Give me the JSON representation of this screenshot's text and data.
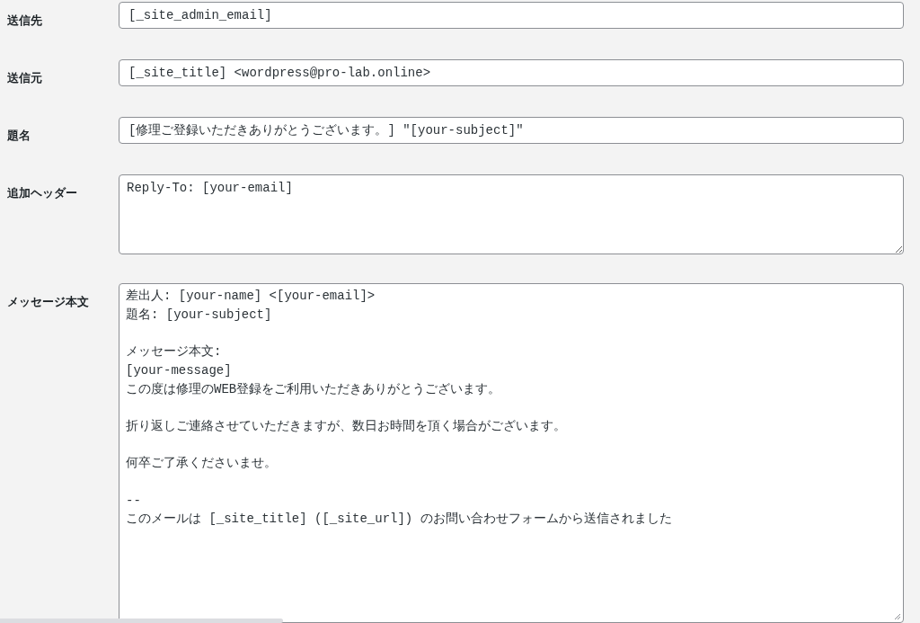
{
  "fields": [
    {
      "label": "送信先",
      "kind": "input",
      "value": "[_site_admin_email]"
    },
    {
      "label": "送信元",
      "kind": "input",
      "value": "[_site_title] <wordpress@pro-lab.online>"
    },
    {
      "label": "題名",
      "kind": "input",
      "value": "[修理ご登録いただきありがとうございます。] \"[your-subject]\""
    },
    {
      "label": "追加ヘッダー",
      "kind": "textarea",
      "value": "Reply-To: [your-email]"
    },
    {
      "label": "メッセージ本文",
      "kind": "textarea_large",
      "paragraphs": [
        [
          "差出人: [your-name] <[your-email]>",
          "題名: [your-subject]"
        ],
        [
          "メッセージ本文:",
          "[your-message]",
          "この度は修理のWEB登録をご利用いただきありがとうございます。"
        ],
        [
          "折り返しご連絡させていただきますが、数日お時間を頂く場合がございます。"
        ],
        [
          "何卒ご了承くださいませ。"
        ],
        [
          "--",
          "このメールは [_site_title] ([_site_url]) のお問い合わせフォームから送信されました"
        ]
      ]
    }
  ]
}
